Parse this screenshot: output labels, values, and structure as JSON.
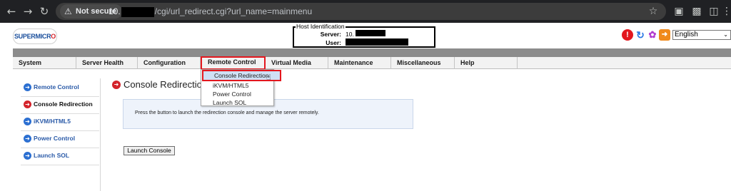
{
  "browser": {
    "security_label": "Not secure",
    "url_prefix": "10.",
    "url_path": "/cgi/url_redirect.cgi?url_name=mainmenu",
    "icons": [
      "back-icon",
      "forward-icon",
      "reload-icon",
      "site-info-icon",
      "bookmark-star-icon",
      "extension-shield-icon",
      "extensions-icon",
      "side-panel-icon",
      "menu-icon"
    ]
  },
  "header": {
    "logo_text": "SUPERMICR",
    "logo_mark": "O",
    "host_box": {
      "legend": "Host Identification",
      "server_label": "Server:",
      "server_value": "10.",
      "user_label": "User:"
    },
    "language_selected": "English",
    "action_icons": [
      "alert-icon",
      "refresh-icon",
      "feather-icon",
      "logout-icon"
    ]
  },
  "menubar": {
    "items": [
      {
        "label": "System"
      },
      {
        "label": "Server Health"
      },
      {
        "label": "Configuration"
      },
      {
        "label": "Remote Control"
      },
      {
        "label": "Virtual Media"
      },
      {
        "label": "Maintenance"
      },
      {
        "label": "Miscellaneous"
      },
      {
        "label": "Help"
      }
    ],
    "active_index": 3
  },
  "dropdown": {
    "items": [
      {
        "label": "Console Redirection"
      },
      {
        "label": "iKVM/HTML5"
      },
      {
        "label": "Power Control"
      },
      {
        "label": "Launch SOL"
      }
    ],
    "highlighted_index": 0
  },
  "sidebar": {
    "items": [
      {
        "label": "Remote Control"
      },
      {
        "label": "Console Redirection"
      },
      {
        "label": "iKVM/HTML5"
      },
      {
        "label": "Power Control"
      },
      {
        "label": "Launch SOL"
      }
    ],
    "current_index": 1
  },
  "main": {
    "title": "Console Redirection",
    "info_text": "Press the button to launch the redirection console and manage the server remotely.",
    "launch_button": "Launch Console"
  },
  "colors": {
    "accent_red": "#e3171e",
    "link_blue": "#2a5aa8",
    "chrome_bg": "#202124"
  }
}
